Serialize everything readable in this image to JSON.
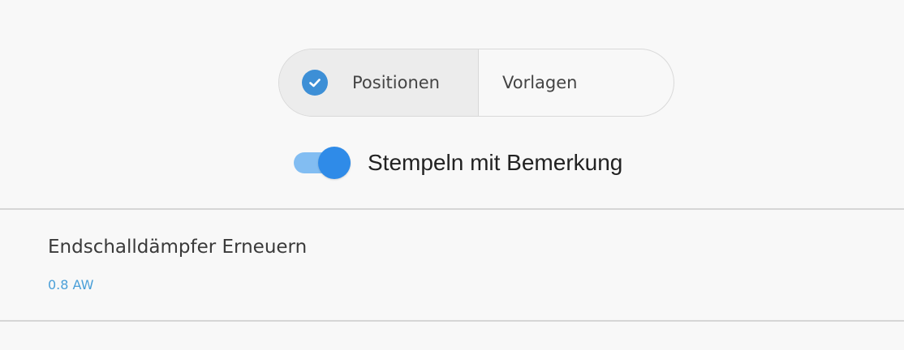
{
  "segmented_control": {
    "options": [
      {
        "label": "Positionen",
        "selected": true,
        "icon": "check-circle-icon"
      },
      {
        "label": "Vorlagen",
        "selected": false
      }
    ]
  },
  "toggle": {
    "label": "Stempeln mit Bemerkung",
    "on": true,
    "color": "#2f8be8"
  },
  "list": {
    "items": [
      {
        "title": "Endschalldämpfer Erneuern",
        "subtitle": "0.8 AW"
      }
    ]
  },
  "colors": {
    "accent": "#3d8fd6",
    "subtitle": "#4a9fd8",
    "background": "#f8f8f8"
  }
}
